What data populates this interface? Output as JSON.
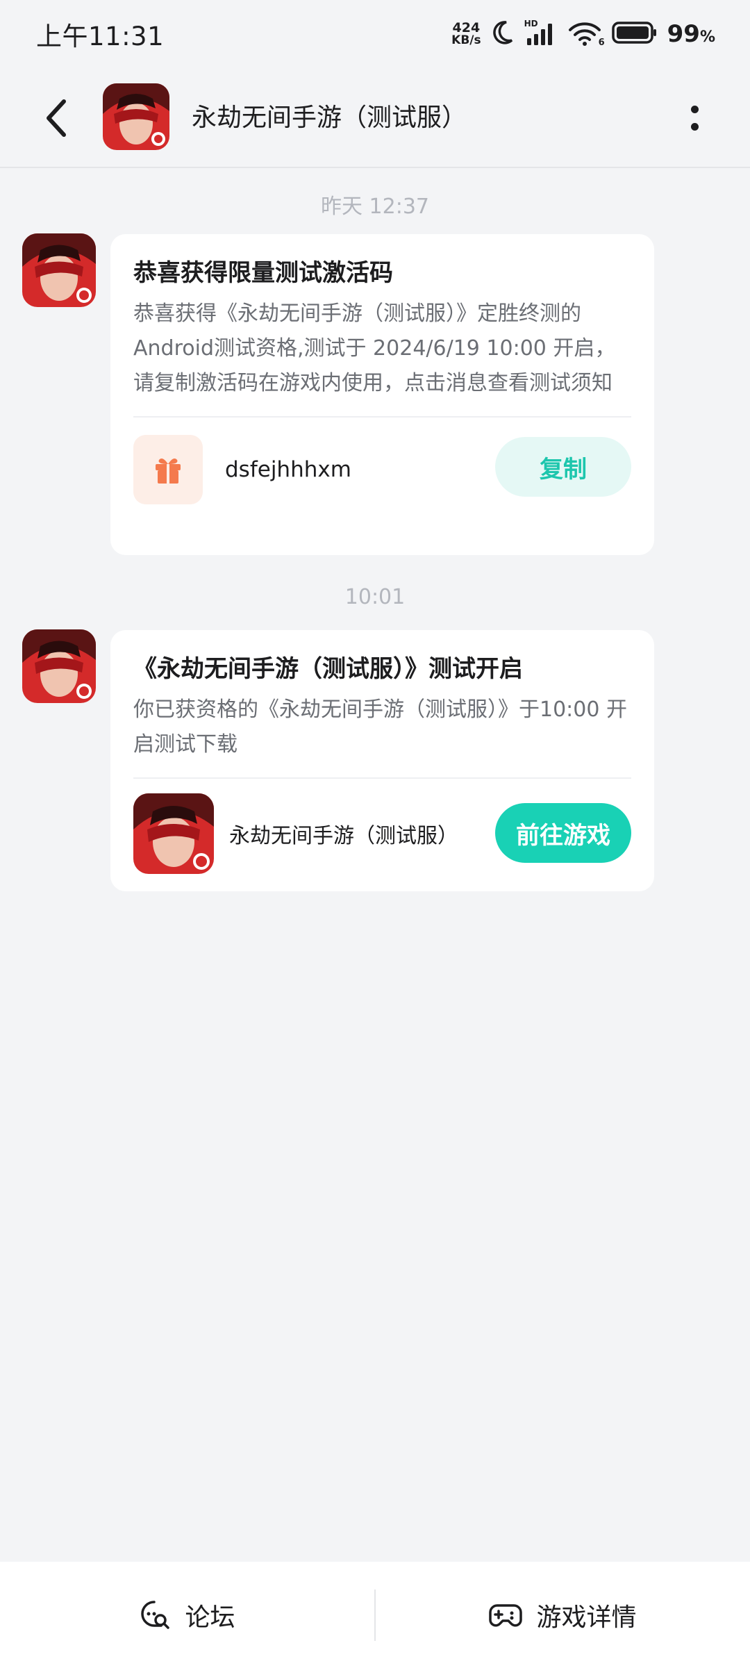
{
  "status_bar": {
    "time": "上午11:31",
    "net_speed_value": "424",
    "net_speed_unit": "KB/s",
    "signal_label": "HD",
    "wifi_label": "6",
    "battery_percent": "99",
    "battery_unit": "%"
  },
  "header": {
    "title": "永劫无间手游（测试服）"
  },
  "messages": [
    {
      "timestamp": "昨天  12:37",
      "title": "恭喜获得限量测试激活码",
      "body": "恭喜获得《永劫无间手游（测试服）》定胜终测的Android测试资格,测试于 2024/6/19 10:00 开启，请复制激活码在游戏内使用，点击消息查看测试须知",
      "code": "dsfejhhhxm",
      "button_label": "复制"
    },
    {
      "timestamp": "10:01",
      "title": "《永劫无间手游（测试服）》测试开启",
      "body": "你已获资格的《永劫无间手游（测试服）》于10:00 开启测试下载",
      "game_name": "永劫无间手游（测试服）",
      "button_label": "前往游戏"
    }
  ],
  "bottom_bar": {
    "forum_label": "论坛",
    "details_label": "游戏详情"
  },
  "colors": {
    "accent": "#19d1b5",
    "accent_light": "#e5f8f5",
    "gift_bg": "#fdeee7",
    "gift_icon": "#f47a4d",
    "background": "#f3f4f6"
  }
}
